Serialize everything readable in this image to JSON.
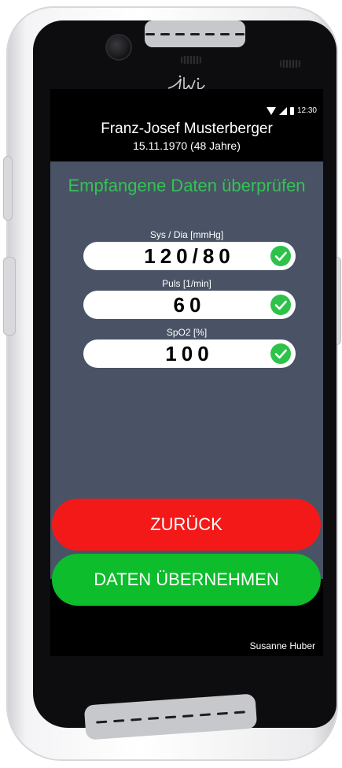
{
  "status_bar": {
    "time": "12:30",
    "icons": [
      "wifi-icon",
      "signal-icon",
      "battery-icon"
    ]
  },
  "patient": {
    "name": "Franz-Josef Musterberger",
    "dob": "15.11.1970 (48 Jahre)"
  },
  "panel": {
    "title": "Empfangene Daten überprüfen",
    "fields": [
      {
        "label": "Sys / Dia [mmHg]",
        "value": "120/80",
        "status_icon": "check-circle-icon"
      },
      {
        "label": "Puls [1/min]",
        "value": "60",
        "status_icon": "check-circle-icon"
      },
      {
        "label": "SpO2 [%]",
        "value": "100",
        "status_icon": "check-circle-icon"
      }
    ]
  },
  "buttons": {
    "back_label": "ZURÜCK",
    "accept_label": "DATEN ÜBERNEHMEN"
  },
  "footer": {
    "user": "Susanne Huber"
  },
  "colors": {
    "panel_bg": "#495365",
    "title_green": "#35c254",
    "check_green": "#2dc249",
    "back_red": "#f41919",
    "accept_green": "#0dbd2c"
  },
  "device": {
    "brand_logo": "ilvi"
  }
}
